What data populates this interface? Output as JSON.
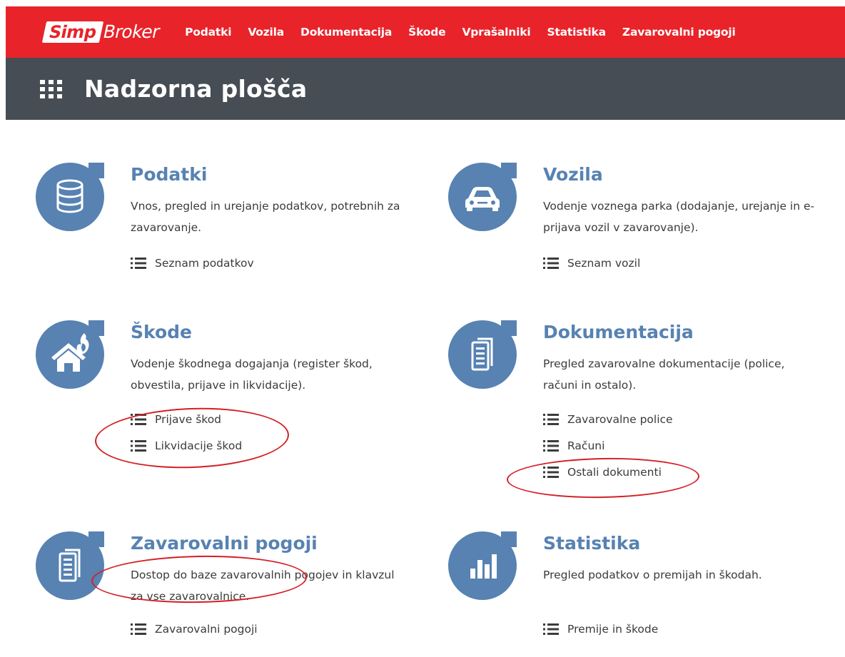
{
  "brand": {
    "part1": "Simp",
    "part2": "Broker"
  },
  "nav": [
    {
      "label": "Podatki"
    },
    {
      "label": "Vozila"
    },
    {
      "label": "Dokumentacija"
    },
    {
      "label": "Škode"
    },
    {
      "label": "Vprašalniki"
    },
    {
      "label": "Statistika"
    },
    {
      "label": "Zavarovalni pogoji"
    }
  ],
  "page": {
    "title": "Nadzorna plošča"
  },
  "cards": {
    "podatki": {
      "icon": "database-icon",
      "title": "Podatki",
      "desc": "Vnos, pregled in urejanje podatkov, potrebnih za zavarovanje.",
      "links": [
        "Seznam podatkov"
      ]
    },
    "vozila": {
      "icon": "car-icon",
      "title": "Vozila",
      "desc": "Vodenje voznega parka (dodajanje, urejanje in e-prijava vozil v zavarovanje).",
      "links": [
        "Seznam vozil"
      ]
    },
    "skode": {
      "icon": "house-fire-icon",
      "title": "Škode",
      "desc": "Vodenje škodnega dogajanja (register škod, obvestila, prijave in likvidacije).",
      "links": [
        "Prijave škod",
        "Likvidacije škod"
      ]
    },
    "dokumentacija": {
      "icon": "document-icon",
      "title": "Dokumentacija",
      "desc": "Pregled zavarovalne dokumentacije (police, računi in ostalo).",
      "links": [
        "Zavarovalne police",
        "Računi",
        "Ostali dokumenti"
      ]
    },
    "pogoji": {
      "icon": "document-icon",
      "title": "Zavarovalni pogoji",
      "desc": "Dostop do baze zavarovalnih pogojev in klavzul za vse zavarovalnice.",
      "links": [
        "Zavarovalni pogoji"
      ]
    },
    "statistika": {
      "icon": "bar-chart-icon",
      "title": "Statistika",
      "desc": "Pregled podatkov o premijah in škodah.",
      "links": [
        "Premije in škode"
      ]
    }
  },
  "colors": {
    "brand_red": "#e8232a",
    "title_bar": "#474d54",
    "accent_blue": "#5782b2",
    "annotation_red": "#d41f26"
  }
}
